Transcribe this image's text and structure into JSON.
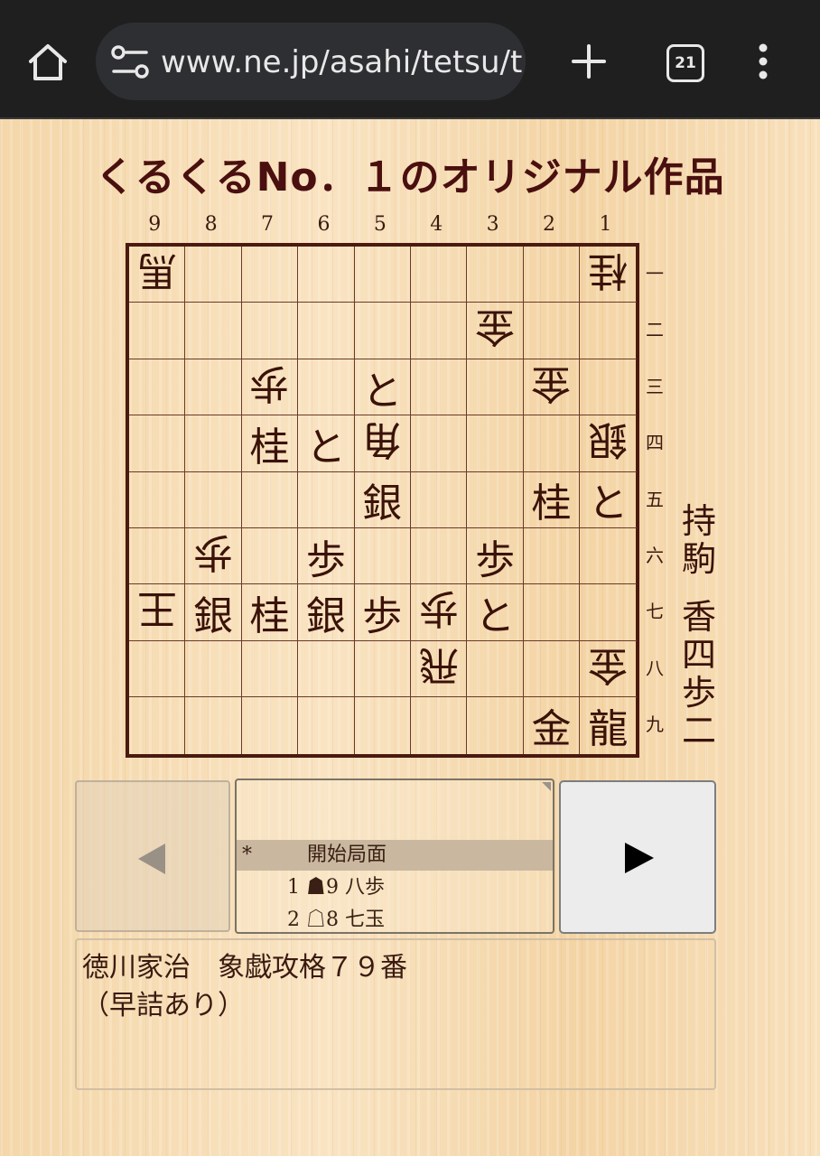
{
  "browser": {
    "url": "www.ne.jp/asahi/tetsu/t",
    "tab_count": "21",
    "icons": [
      "home-icon",
      "site-settings-icon",
      "new-tab-icon",
      "tab-switcher-icon",
      "more-menu-icon"
    ]
  },
  "page": {
    "title": "くるくるNo．１のオリジナル作品"
  },
  "board": {
    "col_labels": [
      "9",
      "8",
      "7",
      "6",
      "5",
      "4",
      "3",
      "2",
      "1"
    ],
    "row_labels": [
      "一",
      "二",
      "三",
      "四",
      "五",
      "六",
      "七",
      "八",
      "九"
    ],
    "squares": [
      [
        "馬g",
        "",
        "",
        "",
        "",
        "",
        "",
        "",
        "桂g"
      ],
      [
        "",
        "",
        "",
        "",
        "",
        "",
        "金g",
        "",
        ""
      ],
      [
        "",
        "",
        "歩g",
        "",
        "と",
        "",
        "",
        "金g",
        ""
      ],
      [
        "",
        "",
        "桂",
        "と",
        "角g",
        "",
        "",
        "",
        "銀g"
      ],
      [
        "",
        "",
        "",
        "",
        "銀",
        "",
        "",
        "桂",
        "と"
      ],
      [
        "",
        "歩g",
        "",
        "歩",
        "",
        "",
        "歩",
        "",
        ""
      ],
      [
        "王g",
        "銀",
        "桂",
        "銀",
        "歩",
        "歩g",
        "と",
        "",
        ""
      ],
      [
        "",
        "",
        "",
        "",
        "",
        "飛g",
        "",
        "",
        "金g"
      ],
      [
        "",
        "",
        "",
        "",
        "",
        "",
        "",
        "金",
        "龍"
      ]
    ]
  },
  "hand": {
    "label": "持駒",
    "pieces": "香四歩二"
  },
  "moves": [
    {
      "num": "*",
      "text": "開始局面",
      "selected": true
    },
    {
      "num": "",
      "text": "1 ☗9 八歩",
      "selected": false
    },
    {
      "num": "",
      "text": "2 ☖8 七玉",
      "selected": false
    }
  ],
  "comment": {
    "line1": "徳川家治　象戯攻格７９番",
    "line2": "（早詰あり）"
  },
  "colors": {
    "title": "#4a0f0f",
    "board_border": "#4a1a10",
    "selected_row": "#c9b89f"
  }
}
